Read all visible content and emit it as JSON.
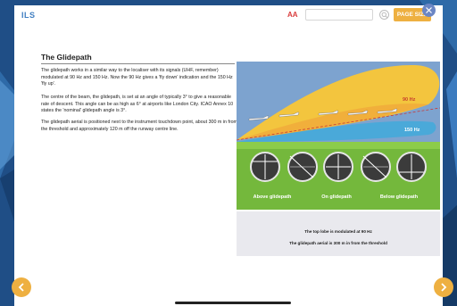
{
  "app": {
    "title": "ILS"
  },
  "toolbar": {
    "font_size_label": "AA",
    "search_placeholder": "",
    "page_size_label": "PAGE SIZE",
    "close_icon": "close-icon",
    "search_icon": "search-icon"
  },
  "content": {
    "title": "The Glidepath",
    "paragraphs": [
      "The glidepath works in a similar way to the localiser with its signals (UHF, remember) modulated at 90 Hz and 150 Hz. Now the 90 Hz gives a 'fly down' indication and the 150 Hz 'fly up'.",
      "The centre of the beam, the glidepath, is set at an angle of typically 3° to give a reasonable rate of descent. This angle can be as high as 6° at airports like London City. ICAO Annex 10 states the 'nominal' glidepath angle is 3°.",
      "The glidepath aerial is positioned next to the instrument touchdown point, about 300 m in from the threshold and approximately 120 m off the runway centre line."
    ]
  },
  "figure": {
    "lobe_upper_label": "90 Hz",
    "lobe_lower_label": "150 Hz",
    "indicator_labels": [
      "Above glidepath",
      "On glidepath",
      "Below glidepath"
    ],
    "colors": {
      "sky": "#7da3cf",
      "upper_lobe": "#f3c53e",
      "lower_lobe": "#4aa9d9",
      "ground": "#74b83c",
      "glidepath_line": "#c83a3a"
    }
  },
  "caption": {
    "line1": "The top lobe is modulated at 90 Hz",
    "line2": "The glidepath aerial is 300 m in from the threshold"
  },
  "navigation": {
    "prev_icon": "chevron-left-icon",
    "next_icon": "chevron-right-icon"
  },
  "theme": {
    "accent": "#eeb041",
    "title_blue": "#3f7ec1",
    "close_blue": "#6b86c4",
    "bg_blue": "#1f4e86"
  }
}
